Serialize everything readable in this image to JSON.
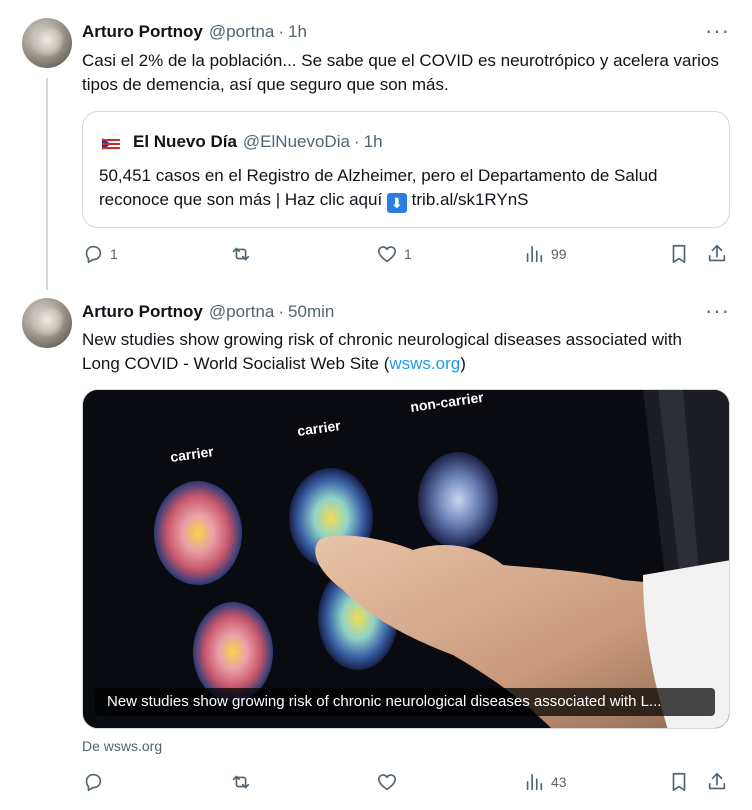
{
  "tweets": [
    {
      "name": "Arturo Portnoy",
      "handle": "@portna",
      "dot": "·",
      "time": "1h",
      "more": "···",
      "text": "Casi el 2% de la población... Se sabe que el COVID es neurotrópico y acelera varios tipos de demencia, así que seguro que son más.",
      "quote": {
        "name": "El Nuevo Día",
        "handle": "@ElNuevoDia",
        "dot": "·",
        "time": "1h",
        "text_before": "50,451 casos en el Registro de Alzheimer, pero el Departamento de Salud reconoce que son más | Haz clic aquí",
        "arrow": "⬇",
        "text_after": "trib.al/sk1RYnS"
      },
      "actions": {
        "replies": "1",
        "reposts": "",
        "likes": "1",
        "views": "99"
      }
    },
    {
      "name": "Arturo Portnoy",
      "handle": "@portna",
      "dot": "·",
      "time": "50min",
      "more": "···",
      "text_before": "New studies show growing risk of chronic neurological diseases associated with Long COVID - World Socialist Web Site (",
      "link": "wsws.org",
      "text_after": ")",
      "media": {
        "labels": {
          "carrier_left": "carrier",
          "carrier_mid": "carrier",
          "non_carrier": "non-carrier"
        },
        "caption": "New studies show growing risk of chronic neurological diseases associated with L..."
      },
      "source": "De wsws.org",
      "actions": {
        "replies": "",
        "reposts": "",
        "likes": "",
        "views": "43"
      }
    }
  ],
  "colors": {
    "accent": "#1d9bf0",
    "muted": "#536471",
    "border": "#cfd9de"
  },
  "icons": [
    "reply-icon",
    "repost-icon",
    "like-icon",
    "views-icon",
    "bookmark-icon",
    "share-icon",
    "more-icon"
  ]
}
